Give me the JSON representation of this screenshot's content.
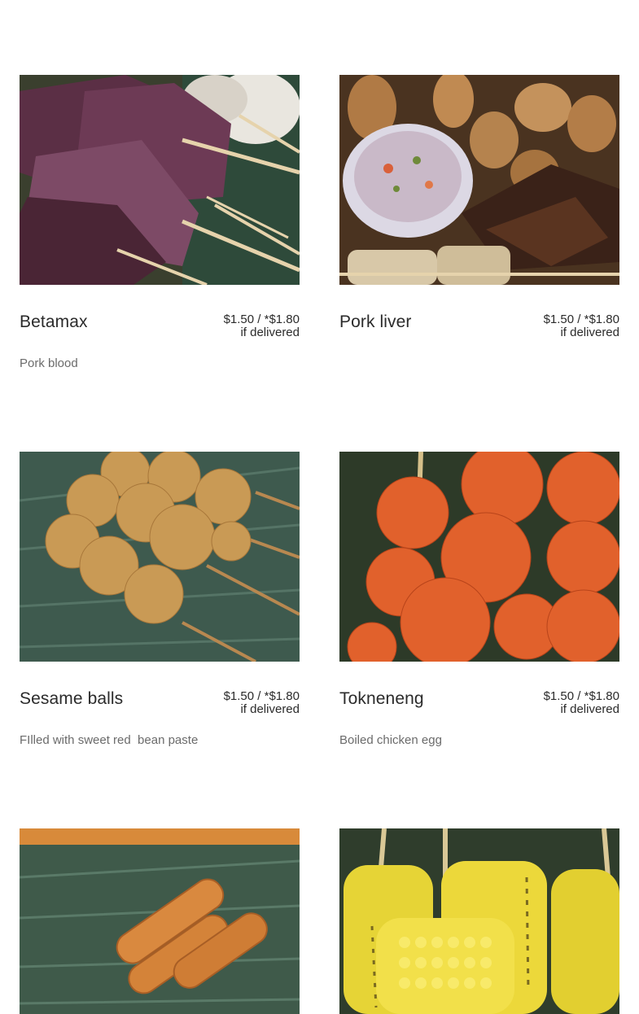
{
  "menu": {
    "items": [
      {
        "name": "Betamax",
        "price_line1": "$1.50 / *$1.80",
        "price_line2": "if delivered",
        "description": "Pork blood",
        "photo_icon": "pork-blood-skewers-photo"
      },
      {
        "name": "Pork liver",
        "price_line1": "$1.50 / *$1.80",
        "price_line2": "if delivered",
        "description": "",
        "photo_icon": "pork-liver-skewers-photo"
      },
      {
        "name": "Sesame balls",
        "price_line1": "$1.50 / *$1.80",
        "price_line2": "if delivered",
        "description": "FIlled with sweet red  bean paste",
        "photo_icon": "sesame-balls-photo"
      },
      {
        "name": "Tokneneng",
        "price_line1": "$1.50 / *$1.80",
        "price_line2": "if delivered",
        "description": "Boiled chicken egg",
        "photo_icon": "tokneneng-photo"
      },
      {
        "name": "",
        "price_line1": "",
        "price_line2": "",
        "description": "",
        "photo_icon": "spring-rolls-photo"
      },
      {
        "name": "",
        "price_line1": "",
        "price_line2": "",
        "description": "",
        "photo_icon": "grilled-corn-photo"
      }
    ]
  },
  "colors": {
    "text": "#2b2b2b",
    "description": "#6b6b6b",
    "background": "#ffffff"
  }
}
